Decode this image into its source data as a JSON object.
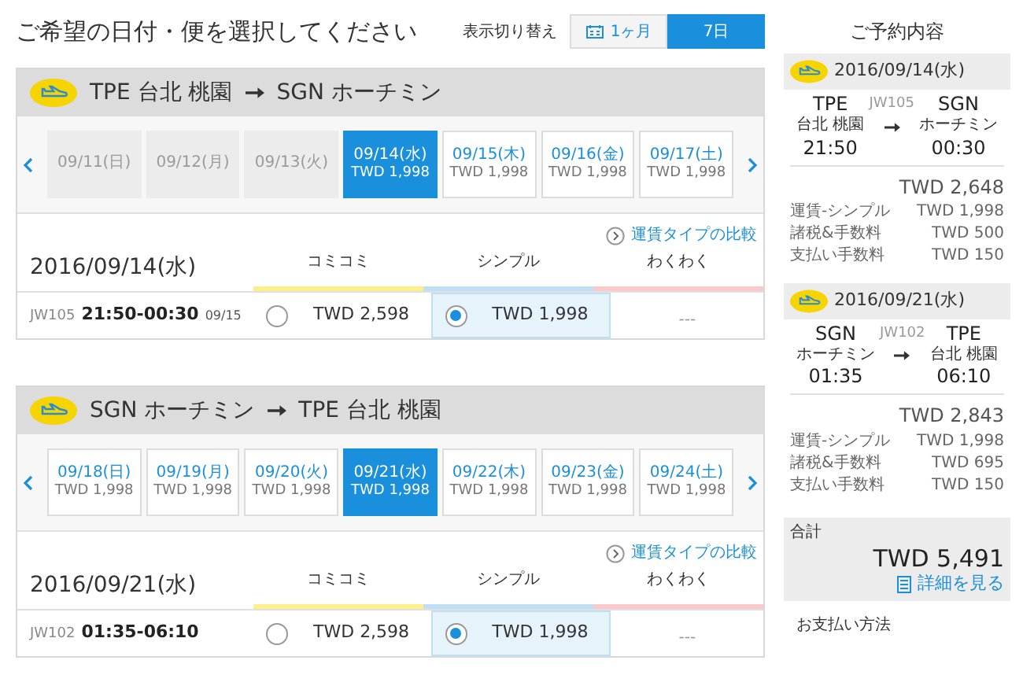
{
  "title": "ご希望の日付・便を選択してください",
  "view_toggle": {
    "label": "表示切り替え",
    "options": [
      {
        "label": "1ヶ月",
        "kind": "calendar",
        "selected": false
      },
      {
        "label": "7日",
        "kind": "plain",
        "selected": true
      }
    ]
  },
  "legs": [
    {
      "route": {
        "from_code": "TPE",
        "from_name": "台北 桃園",
        "to_code": "SGN",
        "to_name": "ホーチミン"
      },
      "dates": [
        {
          "date": "09/11(日)",
          "disabled": true,
          "selected": false
        },
        {
          "date": "09/12(月)",
          "disabled": true,
          "selected": false
        },
        {
          "date": "09/13(火)",
          "disabled": true,
          "selected": false
        },
        {
          "date": "09/14(水)",
          "price": "TWD 1,998",
          "disabled": false,
          "selected": true
        },
        {
          "date": "09/15(木)",
          "price": "TWD 1,998",
          "disabled": false,
          "selected": false
        },
        {
          "date": "09/16(金)",
          "price": "TWD 1,998",
          "disabled": false,
          "selected": false
        },
        {
          "date": "09/17(土)",
          "price": "TWD 1,998",
          "disabled": false,
          "selected": false
        }
      ],
      "compare_link": "運賃タイプの比較",
      "day": "2016/09/14(水)",
      "fare_types": [
        {
          "name": "コミコミ",
          "color": "#fdf08c"
        },
        {
          "name": "シンプル",
          "color": "#bfe0f2"
        },
        {
          "name": "わくわく",
          "color": "#f9c9cc"
        }
      ],
      "flight": {
        "number": "JW105",
        "time": "21:50-00:30",
        "arrival_date": "09/15",
        "fares": [
          {
            "kind": "radio",
            "price": "TWD 2,598",
            "selected": false
          },
          {
            "kind": "radio",
            "price": "TWD 1,998",
            "selected": true
          },
          {
            "kind": "none",
            "price": "---"
          }
        ]
      }
    },
    {
      "route": {
        "from_code": "SGN",
        "from_name": "ホーチミン",
        "to_code": "TPE",
        "to_name": "台北 桃園"
      },
      "dates": [
        {
          "date": "09/18(日)",
          "price": "TWD 1,998",
          "disabled": false,
          "selected": false
        },
        {
          "date": "09/19(月)",
          "price": "TWD 1,998",
          "disabled": false,
          "selected": false
        },
        {
          "date": "09/20(火)",
          "price": "TWD 1,998",
          "disabled": false,
          "selected": false
        },
        {
          "date": "09/21(水)",
          "price": "TWD 1,998",
          "disabled": false,
          "selected": true
        },
        {
          "date": "09/22(木)",
          "price": "TWD 1,998",
          "disabled": false,
          "selected": false
        },
        {
          "date": "09/23(金)",
          "price": "TWD 1,998",
          "disabled": false,
          "selected": false
        },
        {
          "date": "09/24(土)",
          "price": "TWD 1,998",
          "disabled": false,
          "selected": false
        }
      ],
      "compare_link": "運賃タイプの比較",
      "day": "2016/09/21(水)",
      "fare_types": [
        {
          "name": "コミコミ",
          "color": "#fdf08c"
        },
        {
          "name": "シンプル",
          "color": "#bfe0f2"
        },
        {
          "name": "わくわく",
          "color": "#f9c9cc"
        }
      ],
      "flight": {
        "number": "JW102",
        "time": "01:35-06:10",
        "fares": [
          {
            "kind": "radio",
            "price": "TWD 2,598",
            "selected": false
          },
          {
            "kind": "radio",
            "price": "TWD 1,998",
            "selected": true
          },
          {
            "kind": "none",
            "price": "---"
          }
        ]
      }
    }
  ],
  "summary": {
    "title": "ご予約内容",
    "legs": [
      {
        "date": "2016/09/14(水)",
        "from_code": "TPE",
        "from_name": "台北 桃園",
        "depart": "21:50",
        "flight": "JW105",
        "to_code": "SGN",
        "to_name": "ホーチミン",
        "arrive": "00:30",
        "subtotal": "TWD 2,648",
        "lines": [
          {
            "label": "運賃-シンプル",
            "amount": "TWD 1,998"
          },
          {
            "label": "諸税&手数料",
            "amount": "TWD 500"
          },
          {
            "label": "支払い手数料",
            "amount": "TWD 150"
          }
        ]
      },
      {
        "date": "2016/09/21(水)",
        "from_code": "SGN",
        "from_name": "ホーチミン",
        "depart": "01:35",
        "flight": "JW102",
        "to_code": "TPE",
        "to_name": "台北 桃園",
        "arrive": "06:10",
        "subtotal": "TWD 2,843",
        "lines": [
          {
            "label": "運賃-シンプル",
            "amount": "TWD 1,998"
          },
          {
            "label": "諸税&手数料",
            "amount": "TWD 695"
          },
          {
            "label": "支払い手数料",
            "amount": "TWD 150"
          }
        ]
      }
    ],
    "total_label": "合計",
    "total": "TWD 5,491",
    "details_link": "詳細を見る",
    "payment_heading": "お支払い方法"
  }
}
